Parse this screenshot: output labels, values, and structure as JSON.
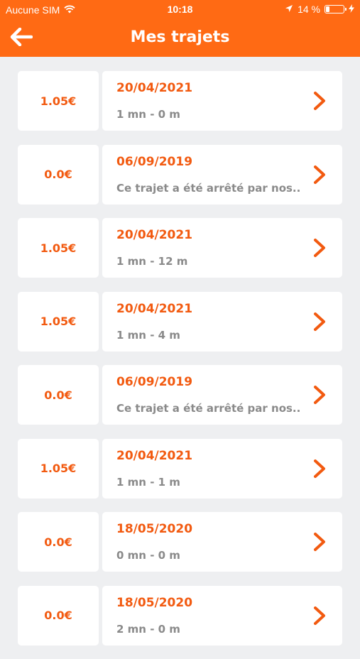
{
  "status_bar": {
    "carrier": "Aucune SIM",
    "time": "10:18",
    "battery": "14 %"
  },
  "header": {
    "title": "Mes trajets"
  },
  "trips": [
    {
      "price": "1.05€",
      "date": "20/04/2021",
      "detail": "1 mn - 0 m"
    },
    {
      "price": "0.0€",
      "date": "06/09/2019",
      "detail": "Ce trajet a été arrêté par nos..."
    },
    {
      "price": "1.05€",
      "date": "20/04/2021",
      "detail": "1 mn - 12 m"
    },
    {
      "price": "1.05€",
      "date": "20/04/2021",
      "detail": "1 mn - 4 m"
    },
    {
      "price": "0.0€",
      "date": "06/09/2019",
      "detail": "Ce trajet a été arrêté par nos..."
    },
    {
      "price": "1.05€",
      "date": "20/04/2021",
      "detail": "1 mn - 1 m"
    },
    {
      "price": "0.0€",
      "date": "18/05/2020",
      "detail": "0 mn - 0 m"
    },
    {
      "price": "0.0€",
      "date": "18/05/2020",
      "detail": "2 mn - 0 m"
    }
  ],
  "colors": {
    "brand": "#FF6A14",
    "accent_text": "#F25A10",
    "secondary_text": "#8A8A8A",
    "background": "#EEEFF1"
  },
  "icons": {
    "back": "arrow-left-icon",
    "row_chevron": "chevron-right-icon",
    "wifi": "wifi-icon",
    "location": "location-arrow-icon",
    "battery": "battery-icon",
    "charging": "charging-bolt-icon"
  }
}
